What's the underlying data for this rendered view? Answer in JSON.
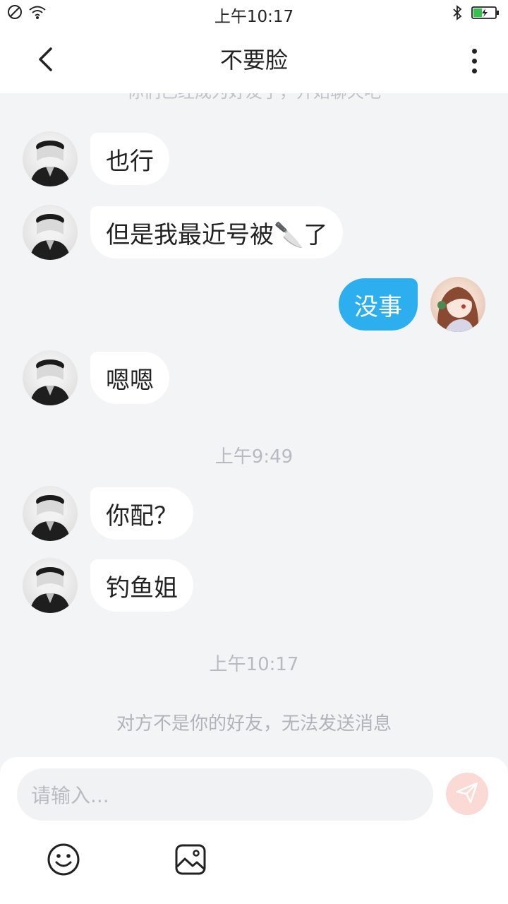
{
  "status_bar": {
    "time": "上午10:17",
    "icons": [
      "no-sim-icon",
      "wifi-icon",
      "bluetooth-icon",
      "battery-charging-icon"
    ]
  },
  "header": {
    "title": "不要脸",
    "back_icon": "chevron-left-icon",
    "menu_icon": "more-vertical-icon"
  },
  "chat": {
    "system_partial": "你们已经成为好友了，开始聊天吧",
    "messages": [
      {
        "side": "left",
        "text": "也行"
      },
      {
        "side": "left",
        "text": "但是我最近号被🔪了"
      },
      {
        "side": "right",
        "text": "没事"
      },
      {
        "side": "left",
        "text": "嗯嗯"
      },
      {
        "side": "left",
        "text": "你配？"
      },
      {
        "side": "left",
        "text": "钓鱼姐"
      }
    ],
    "timestamp_1": "上午9:49",
    "timestamp_2": "上午10:17",
    "notice": "对方不是你的好友，无法发送消息"
  },
  "input": {
    "placeholder": "请输入...",
    "send_icon": "send-icon",
    "emoji_icon": "smiley-icon",
    "image_icon": "image-icon"
  },
  "colors": {
    "background": "#f3f4f6",
    "outgoing_bubble": "#2daeef",
    "incoming_bubble": "#ffffff",
    "send_button": "#fbd9d4"
  }
}
